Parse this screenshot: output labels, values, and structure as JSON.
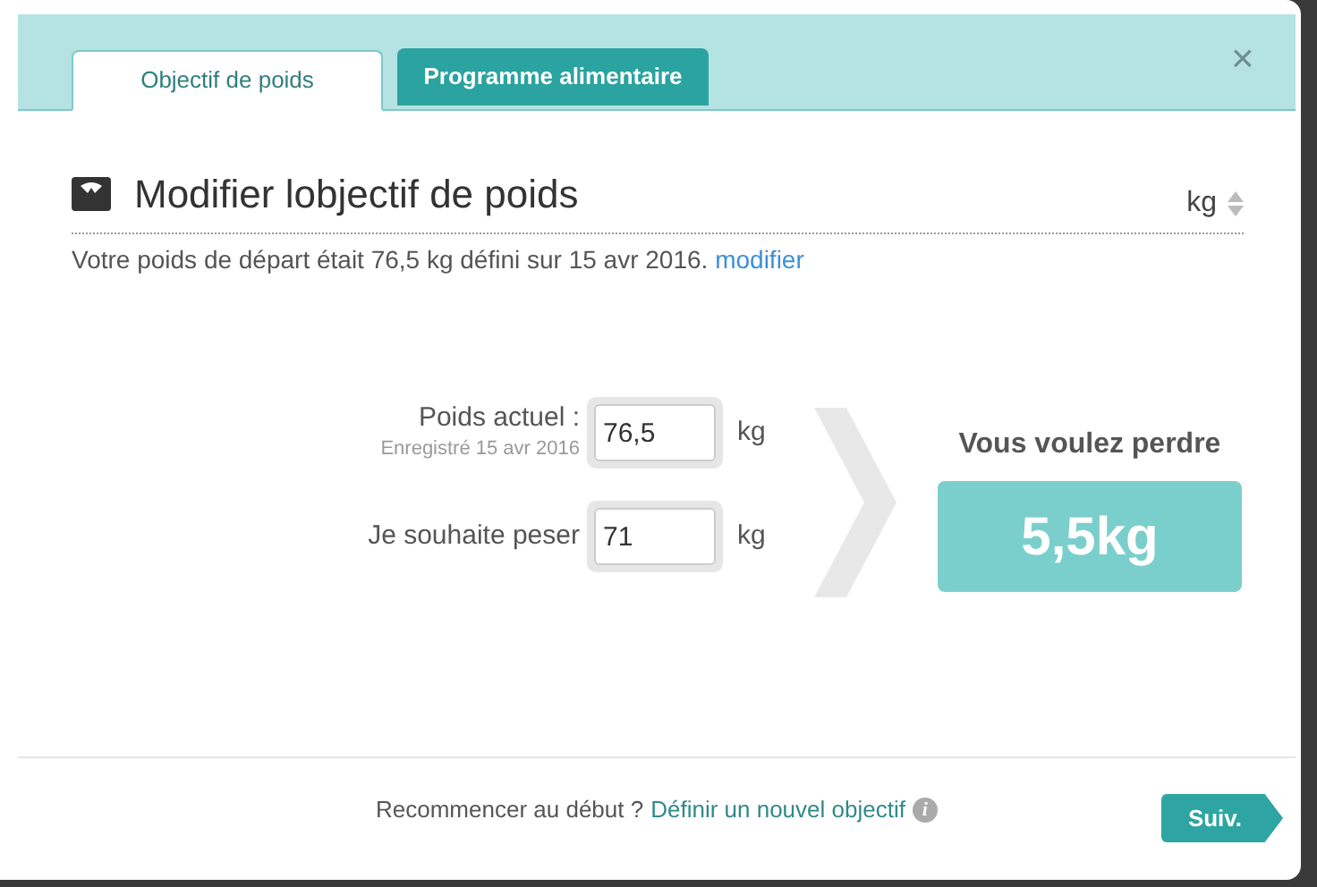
{
  "tabs": [
    {
      "label": "Objectif de poids",
      "selected": true
    },
    {
      "label": "Programme alimentaire",
      "selected": false
    }
  ],
  "close": "×",
  "heading": {
    "title": "Modifier lobjectif de poids",
    "unit": "kg"
  },
  "summary": {
    "text": "Votre poids de départ était 76,5 kg défini sur 15 avr 2016.",
    "link": "modifier"
  },
  "fields": [
    {
      "label": "Poids actuel :",
      "note": "Enregistré 15 avr 2016",
      "value": "76,5",
      "unit": "kg"
    },
    {
      "label": "Je souhaite peser",
      "value": "71",
      "unit": "kg"
    }
  ],
  "result": {
    "label": "Vous voulez perdre",
    "value": "5,5kg"
  },
  "footer": {
    "text": "Recommencer au début ?",
    "link": "Définir un nouvel objectif",
    "info": "i",
    "button": "Suiv."
  }
}
